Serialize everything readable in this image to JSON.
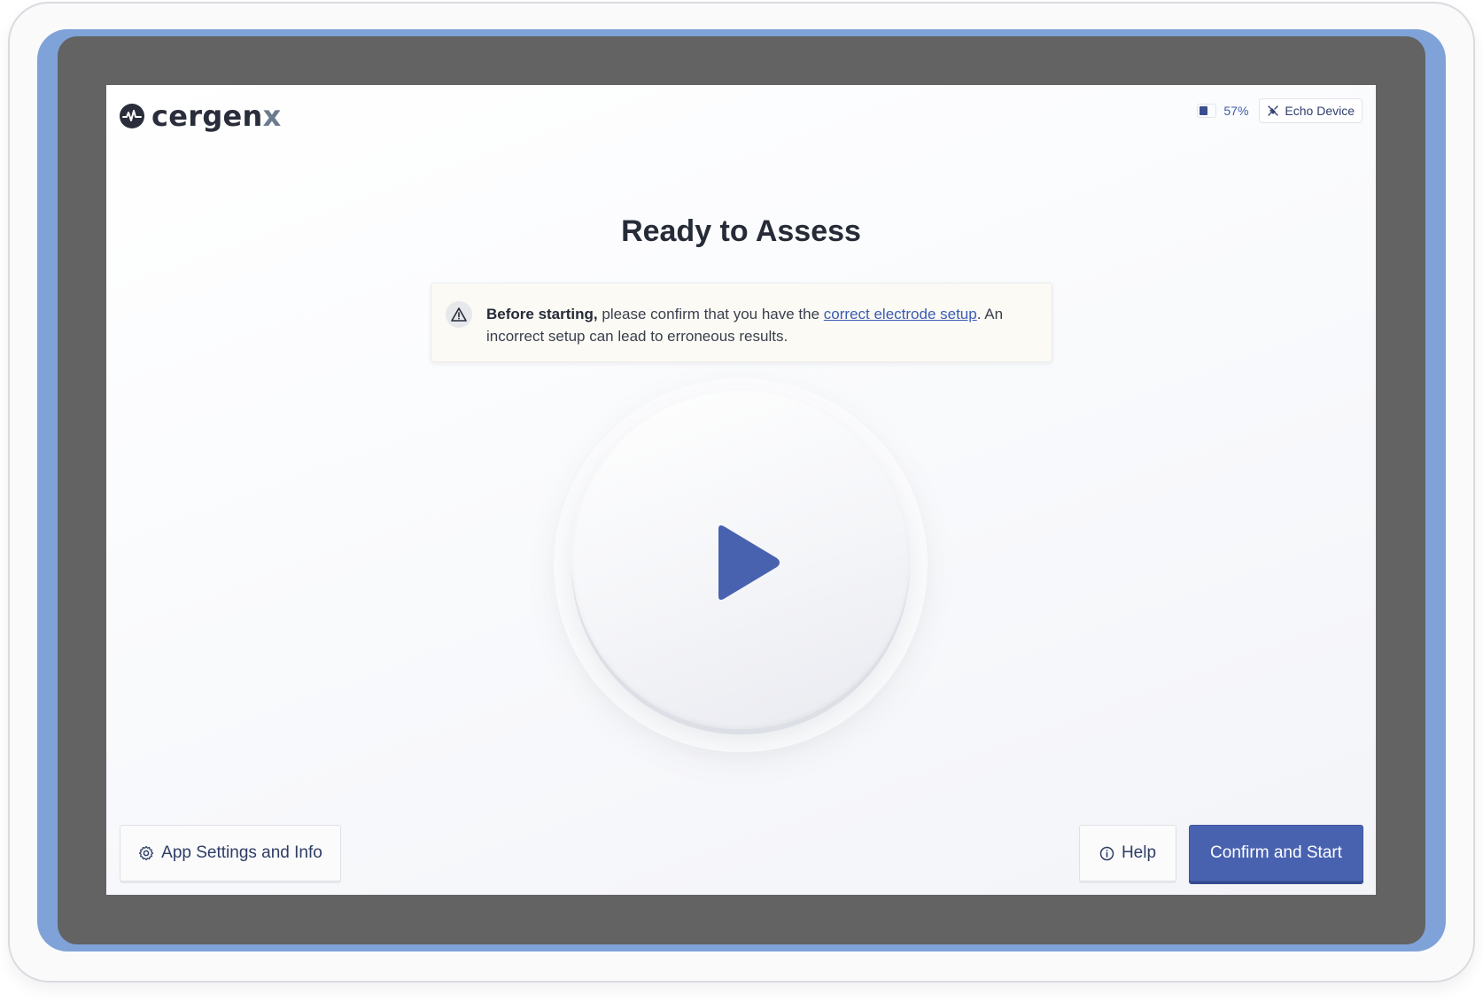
{
  "brand": {
    "name_main": "cergen",
    "name_accent": "x",
    "logo_icon": "head-waveform-icon"
  },
  "status": {
    "battery_percent": 57,
    "battery_label": "57%",
    "device_icon": "plug-disconnected-icon",
    "device_label": "Echo Device"
  },
  "main": {
    "title": "Ready to Assess",
    "warning": {
      "icon": "warning-triangle-icon",
      "lead": "Before starting,",
      "text_before_link": " please confirm that you have the ",
      "link_text": "correct electrode setup",
      "text_after_link": ". An incorrect setup can lead to erroneous results."
    },
    "play_icon": "play-icon"
  },
  "footer": {
    "settings_label": "App Settings and Info",
    "settings_icon": "gear-icon",
    "help_label": "Help",
    "help_icon": "info-icon",
    "start_label": "Confirm and Start"
  },
  "colors": {
    "accent": "#4862b0",
    "frame": "#7fa3d8",
    "bezel": "#636363",
    "text_dark": "#262b38"
  }
}
